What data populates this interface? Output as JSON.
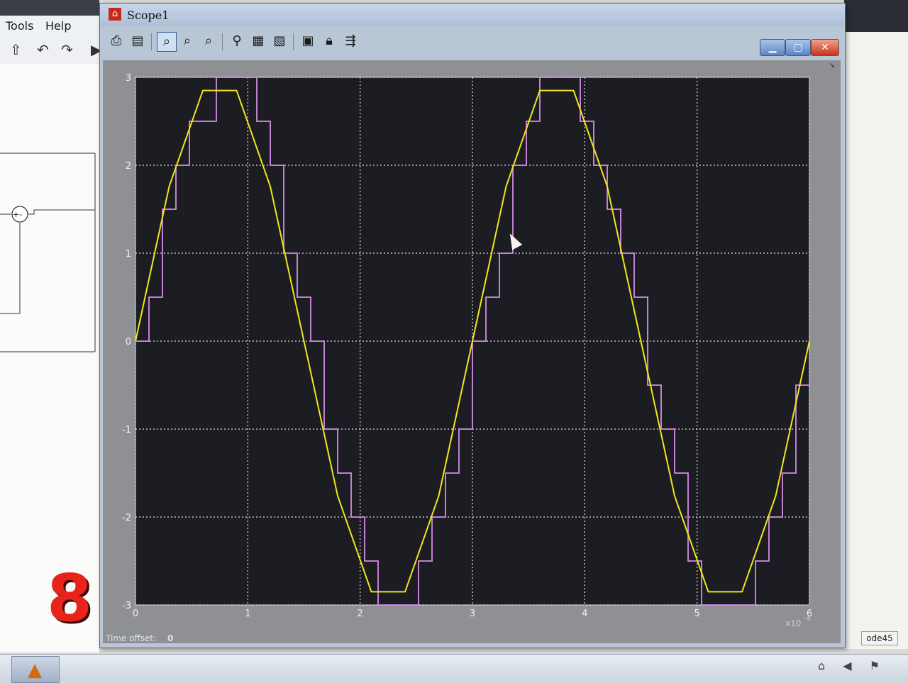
{
  "background_app": {
    "menu": [
      "Tools",
      "Help"
    ],
    "toolbar_icons": [
      "up-arrow-icon",
      "undo-icon",
      "redo-icon",
      "play-icon"
    ],
    "solver": "ode45"
  },
  "overlay_number": "8",
  "scope": {
    "title": "Scope1",
    "toolbar_icons": [
      "print-icon",
      "parameters-icon",
      "zoom-icon",
      "zoom-x-icon",
      "zoom-y-icon",
      "autoscale-icon",
      "save-axes-icon",
      "restore-axes-icon",
      "floating-scope-icon",
      "lock-icon",
      "signal-selection-icon"
    ],
    "window_buttons": {
      "minimize": "▁",
      "maximize": "▢",
      "close": "✕"
    },
    "time_offset_label": "Time offset:",
    "time_offset_value": "0"
  },
  "colors": {
    "plot_background": "#1c1d22",
    "grid": "#e6e6e6",
    "continuous_signal": "#f2e61a",
    "sampled_signal": "#d68ce8",
    "axes_text": "#f0f0f0"
  },
  "chart_data": {
    "type": "line",
    "title": "",
    "xlabel": "",
    "ylabel": "",
    "xlim": [
      0,
      6
    ],
    "ylim": [
      -3,
      3
    ],
    "x_ticks": [
      "0",
      "1",
      "2",
      "3",
      "4",
      "5",
      "6"
    ],
    "y_ticks": [
      "-3",
      "-2",
      "-1",
      "0",
      "1",
      "2",
      "3"
    ],
    "x_exponent": "x10",
    "x_exponent_power": "-4",
    "grid": true,
    "series": [
      {
        "style": "smooth",
        "x": [
          0,
          0.3,
          0.6,
          0.9,
          1.2,
          1.5,
          1.8,
          2.1,
          2.4,
          2.7,
          3.0,
          3.3,
          3.6,
          3.9,
          4.2,
          4.5,
          4.8,
          5.1,
          5.4,
          5.7,
          6.0
        ],
        "y": [
          0,
          1.76,
          2.85,
          2.85,
          1.76,
          0,
          -1.76,
          -2.85,
          -2.85,
          -1.76,
          0,
          1.76,
          2.85,
          2.85,
          1.76,
          0,
          -1.76,
          -2.85,
          -2.85,
          -1.76,
          0
        ]
      },
      {
        "style": "staircase",
        "x": [
          0,
          0.12,
          0.24,
          0.36,
          0.48,
          0.6,
          0.72,
          0.84,
          0.96,
          1.08,
          1.2,
          1.32,
          1.44,
          1.56,
          1.68,
          1.8,
          1.92,
          2.04,
          2.16,
          2.28,
          2.4,
          2.52,
          2.64,
          2.76,
          2.88,
          3.0,
          3.12,
          3.24,
          3.36,
          3.48,
          3.6,
          3.72,
          3.84,
          3.96,
          4.08,
          4.2,
          4.32,
          4.44,
          4.56,
          4.68,
          4.8,
          4.92,
          5.04,
          5.16,
          5.28,
          5.4,
          5.52,
          5.64,
          5.76,
          5.88
        ],
        "y": [
          0,
          0.5,
          1.5,
          2.0,
          2.5,
          2.5,
          3.0,
          3.0,
          3.0,
          2.5,
          2.0,
          1.0,
          0.5,
          0,
          -1.0,
          -1.5,
          -2.0,
          -2.5,
          -3.0,
          -3.0,
          -3.0,
          -2.5,
          -2.0,
          -1.5,
          -1.0,
          0,
          0.5,
          1.0,
          2.0,
          2.5,
          3.0,
          3.0,
          3.0,
          2.5,
          2.0,
          1.5,
          1.0,
          0.5,
          -0.5,
          -1.0,
          -1.5,
          -2.5,
          -3.0,
          -3.0,
          -3.0,
          -3.0,
          -2.5,
          -2.0,
          -1.5,
          -0.5
        ]
      }
    ]
  }
}
